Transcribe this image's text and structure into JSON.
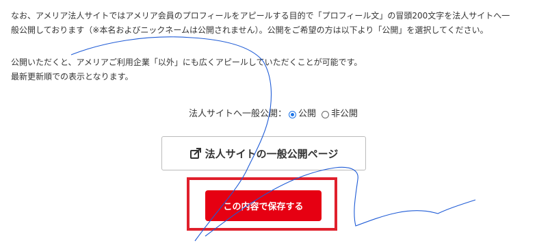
{
  "description": {
    "line1": "なお、アメリア法人サイトではアメリア会員のプロフィールをアピールする目的で「プロフィール文」の冒頭200文字を法人サイトへ一",
    "line2": "般公開しております（※本名およびニックネームは公開されません）。公開をご希望の方は以下より「公開」を選択してください。",
    "line3": "公開いただくと、アメリアご利用企業「以外」にも広くアピールしていただくことが可能です。",
    "line4": "最新更新順での表示となります。"
  },
  "visibility": {
    "label": "法人サイトへ一般公開：",
    "options": [
      {
        "label": "公開",
        "checked": true
      },
      {
        "label": "非公開",
        "checked": false
      }
    ]
  },
  "public_page_button": {
    "label": "法人サイトの一般公開ページ",
    "icon": "external-link-icon"
  },
  "save_button": {
    "label": "この内容で保存する"
  },
  "colors": {
    "accent_red": "#e60012",
    "highlight_frame": "#e0202c",
    "radio_blue": "#1a73e8",
    "scribble_blue": "#1e5bd6"
  }
}
